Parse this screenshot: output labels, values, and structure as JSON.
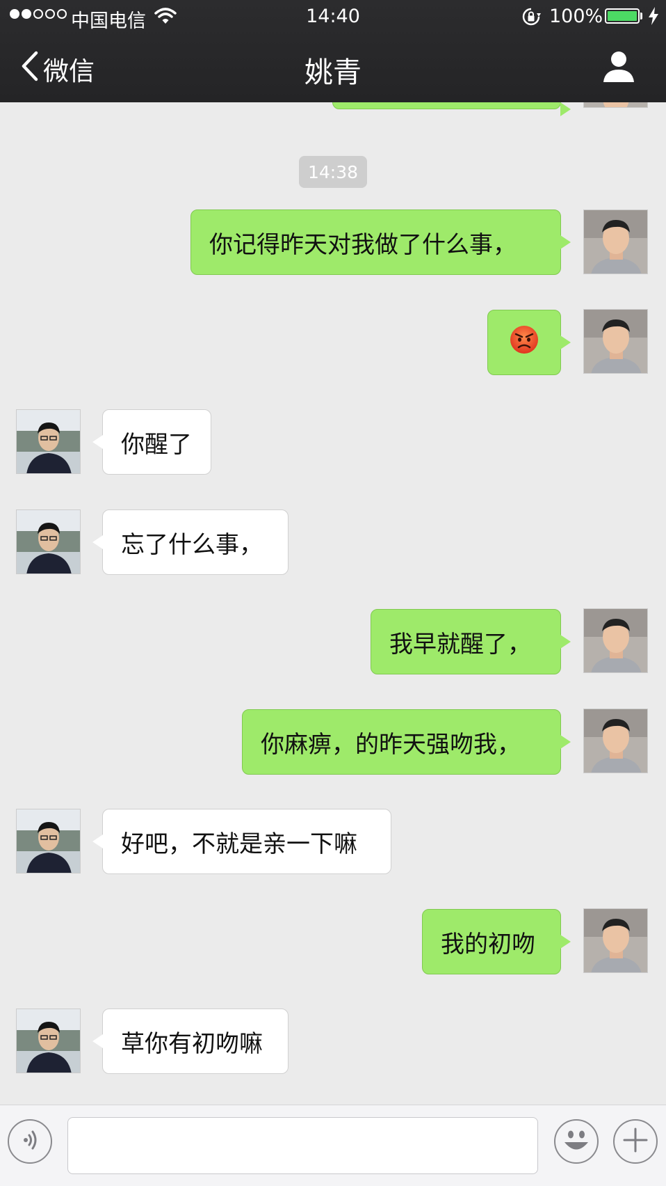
{
  "status_bar": {
    "carrier": "中国电信",
    "time": "14:40",
    "battery_percent": "100%",
    "battery_level": 1.0,
    "signal_bars_filled": 2,
    "signal_bars_total": 5
  },
  "nav": {
    "back_label": "微信",
    "title": "姚青",
    "back_icon": "chevron-left-icon",
    "profile_icon": "person-icon"
  },
  "chat": {
    "time_separator": "14:38",
    "messages": [
      {
        "from": "me",
        "text": "你记得昨天对我做了什么事，"
      },
      {
        "from": "me",
        "emoji": "angry-face-icon"
      },
      {
        "from": "them",
        "text": "你醒了"
      },
      {
        "from": "them",
        "text": "忘了什么事，"
      },
      {
        "from": "me",
        "text": "我早就醒了，"
      },
      {
        "from": "me",
        "text": "你麻痹，的昨天强吻我，"
      },
      {
        "from": "them",
        "text": "好吧，不就是亲一下嘛"
      },
      {
        "from": "me",
        "text": "我的初吻"
      },
      {
        "from": "them",
        "text": "草你有初吻嘛"
      }
    ]
  },
  "input_bar": {
    "voice_icon": "voice-icon",
    "emoji_icon": "smiley-icon",
    "more_icon": "plus-icon",
    "input_value": ""
  },
  "colors": {
    "sent_bubble": "#9eea6a",
    "received_bubble": "#ffffff",
    "background": "#ebebeb",
    "nav_bar": "#2a2a2c",
    "battery": "#4cd964"
  }
}
